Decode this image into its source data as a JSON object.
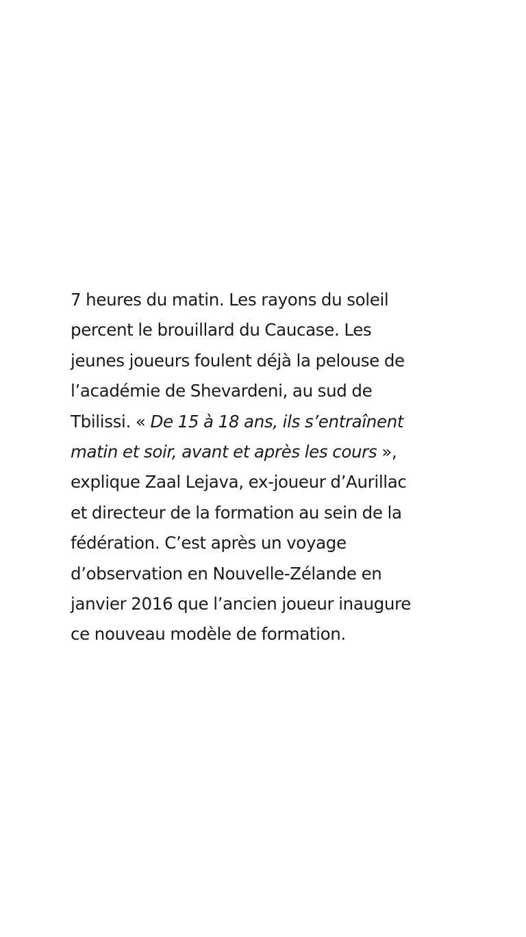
{
  "article": {
    "lines": [
      {
        "text": "7 heures du matin. Les rayons du soleil"
      },
      {
        "text": "percent le brouillard du Caucase. Les"
      },
      {
        "text": "jeunes joueurs foulent déjà la pelouse de"
      },
      {
        "text": "l’académie de Shevardeni, au sud de"
      },
      {
        "before": "Tbilissi. « ",
        "italic": "De 15 à 18 ans, ils s’entraînent"
      },
      {
        "italic": "matin et soir, avant et après les cours",
        "after": " »,"
      },
      {
        "text": "explique Zaal Lejava, ex-joueur d’Aurillac"
      },
      {
        "text": "et directeur de la formation au sein de la"
      },
      {
        "text": "fédération. C’est après un voyage"
      },
      {
        "text": "d’observation en Nouvelle-Zélande en"
      },
      {
        "text": "janvier 2016 que l’ancien joueur inaugure"
      },
      {
        "text": "ce nouveau modèle de formation."
      }
    ]
  }
}
